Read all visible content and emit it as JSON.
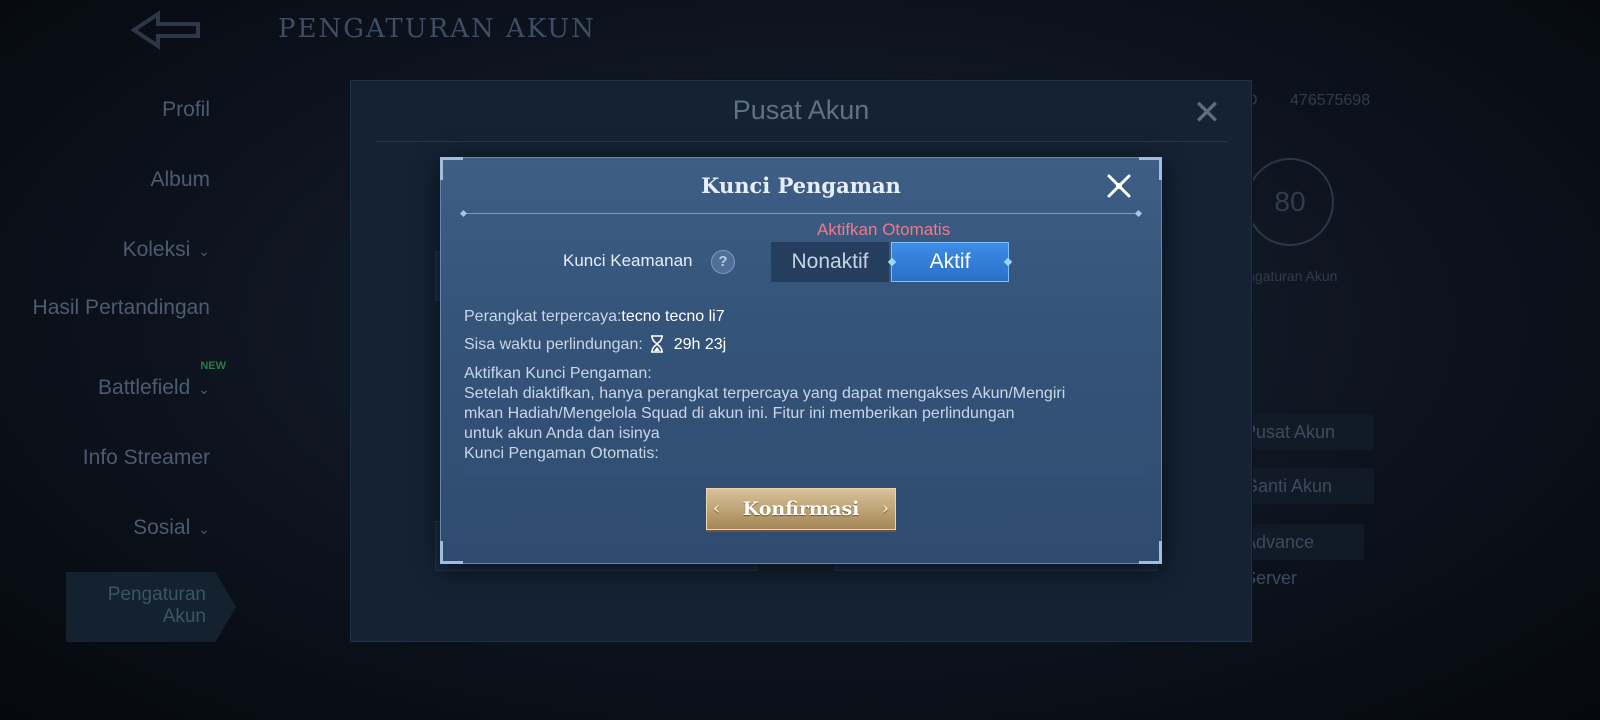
{
  "background": {
    "page_title": "PENGATURAN AKUN",
    "side_nav": [
      {
        "label": "Profil",
        "has_chevron": false
      },
      {
        "label": "Album",
        "has_chevron": false
      },
      {
        "label": "Koleksi",
        "has_chevron": true
      },
      {
        "label": "Hasil Pertandingan",
        "has_chevron": false
      },
      {
        "label": "Battlefield",
        "has_chevron": true,
        "badge": "NEW"
      },
      {
        "label": "Info Streamer",
        "has_chevron": false
      },
      {
        "label": "Sosial",
        "has_chevron": true
      },
      {
        "label": "Pengaturan Akun",
        "active": true
      }
    ],
    "right_panel": {
      "uid_label": "UID",
      "uid_value": "476575698",
      "score": "80",
      "settings_label": "Pengaturan Akun",
      "buttons": [
        "Pusat Akun",
        "Ganti Akun",
        "Advance Server"
      ]
    }
  },
  "account_center": {
    "title": "Pusat Akun",
    "close_icon": "close-icon"
  },
  "lock_modal": {
    "title": "Kunci Pengaman",
    "auto_label": "Aktifkan Otomatis",
    "lock_label": "Kunci Keamanan",
    "help_icon": "?",
    "toggle": {
      "off": "Nonaktif",
      "on": "Aktif",
      "selected": "Aktif"
    },
    "trusted_device_label": "Perangkat terpercaya:",
    "trusted_device_value": "tecno tecno li7",
    "protection_label": "Sisa waktu perlindungan:",
    "protection_value": "29h 23j",
    "desc_heading": "Aktifkan Kunci Pengaman:",
    "desc_line1": "Setelah diaktifkan, hanya perangkat terpercaya yang dapat mengakses Akun/Mengiri",
    "desc_line2": "mkan Hadiah/Mengelola Squad di akun ini. Fitur ini memberikan perlindungan",
    "desc_line3": "untuk akun Anda dan isinya",
    "desc_heading2": "Kunci Pengaman Otomatis:",
    "confirm_label": "Konfirmasi"
  }
}
